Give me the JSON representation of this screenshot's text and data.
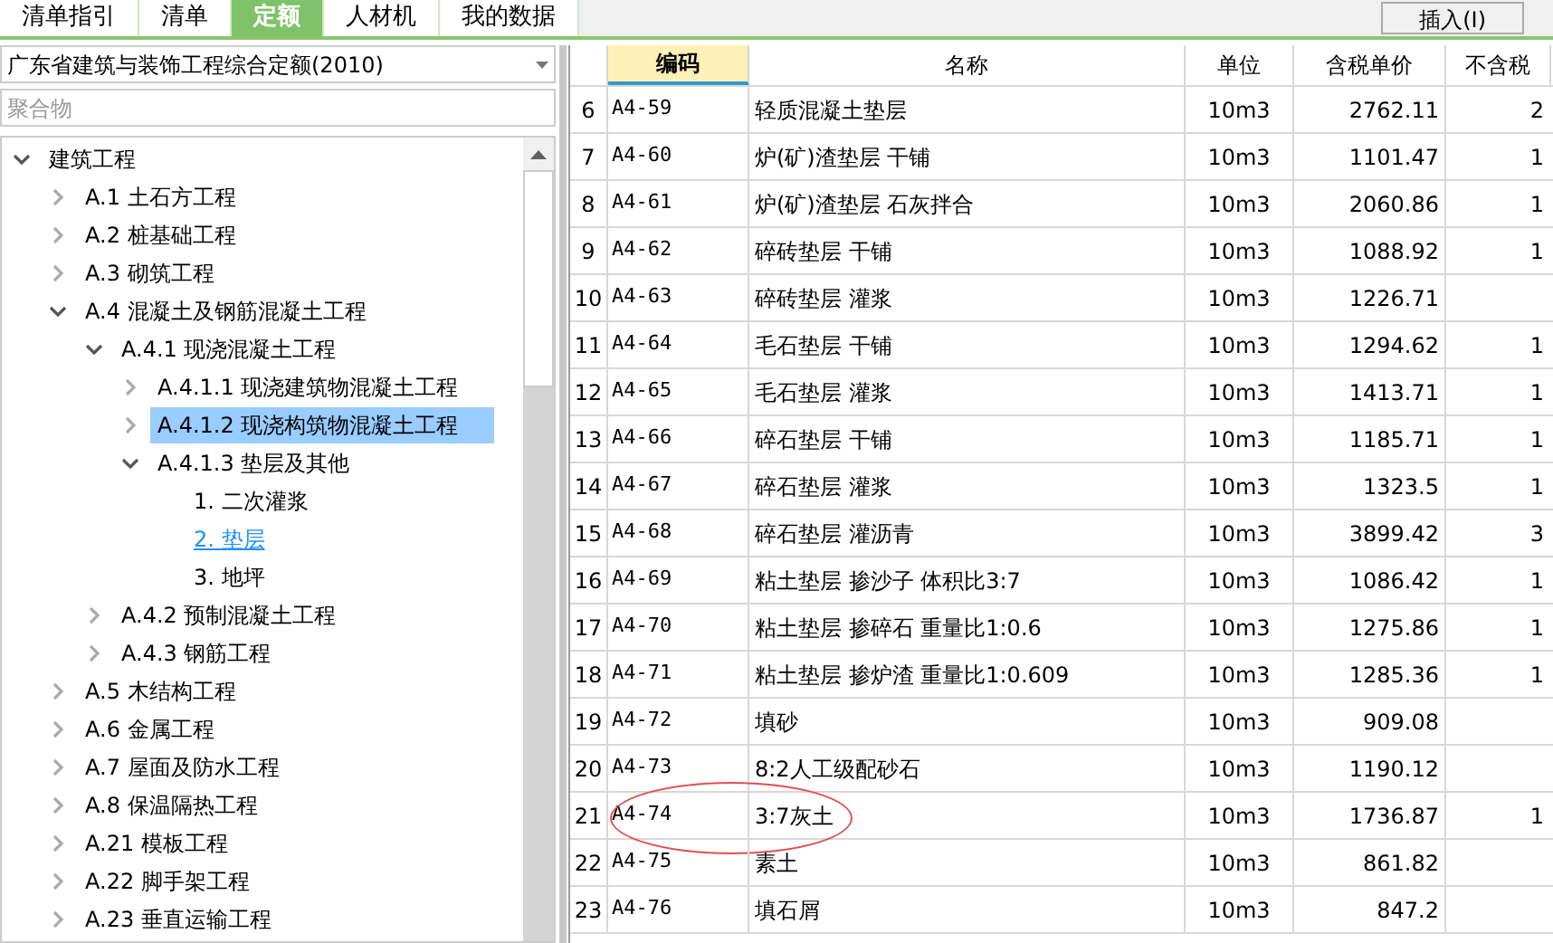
{
  "tabs": [
    {
      "label": "清单指引",
      "selected": false
    },
    {
      "label": "清单",
      "selected": false
    },
    {
      "label": "定额",
      "selected": true
    },
    {
      "label": "人材机",
      "selected": false
    },
    {
      "label": "我的数据",
      "selected": false
    }
  ],
  "insert_button": "插入(I)",
  "library_select": {
    "value": "广东省建筑与装饰工程综合定额(2010)"
  },
  "search": {
    "placeholder": "聚合物"
  },
  "tree": [
    {
      "label": "建筑工程",
      "expanded": true,
      "selected": false,
      "current": false,
      "children": [
        {
          "label": "A.1 土石方工程",
          "expanded": false,
          "selected": false,
          "current": false
        },
        {
          "label": "A.2 桩基础工程",
          "expanded": false,
          "selected": false,
          "current": false
        },
        {
          "label": "A.3 砌筑工程",
          "expanded": false,
          "selected": false,
          "current": false
        },
        {
          "label": "A.4 混凝土及钢筋混凝土工程",
          "expanded": true,
          "selected": false,
          "current": false,
          "children": [
            {
              "label": "A.4.1 现浇混凝土工程",
              "expanded": true,
              "selected": false,
              "current": false,
              "children": [
                {
                  "label": "A.4.1.1 现浇建筑物混凝土工程",
                  "expanded": false,
                  "selected": false,
                  "current": false
                },
                {
                  "label": "A.4.1.2 现浇构筑物混凝土工程",
                  "expanded": false,
                  "selected": true,
                  "current": false
                },
                {
                  "label": "A.4.1.3 垫层及其他",
                  "expanded": true,
                  "selected": false,
                  "current": false,
                  "children": [
                    {
                      "label": "1. 二次灌浆",
                      "selected": false,
                      "current": false
                    },
                    {
                      "label": "2. 垫层",
                      "selected": false,
                      "current": true
                    },
                    {
                      "label": "3. 地坪",
                      "selected": false,
                      "current": false
                    }
                  ]
                }
              ]
            },
            {
              "label": "A.4.2 预制混凝土工程",
              "expanded": false,
              "selected": false,
              "current": false
            },
            {
              "label": "A.4.3 钢筋工程",
              "expanded": false,
              "selected": false,
              "current": false
            }
          ]
        },
        {
          "label": "A.5 木结构工程",
          "expanded": false,
          "selected": false,
          "current": false
        },
        {
          "label": "A.6 金属工程",
          "expanded": false,
          "selected": false,
          "current": false
        },
        {
          "label": "A.7 屋面及防水工程",
          "expanded": false,
          "selected": false,
          "current": false
        },
        {
          "label": "A.8 保温隔热工程",
          "expanded": false,
          "selected": false,
          "current": false
        },
        {
          "label": "A.21 模板工程",
          "expanded": false,
          "selected": false,
          "current": false
        },
        {
          "label": "A.22 脚手架工程",
          "expanded": false,
          "selected": false,
          "current": false
        },
        {
          "label": "A.23 垂直运输工程",
          "expanded": false,
          "selected": false,
          "current": false
        }
      ]
    }
  ],
  "table": {
    "columns": [
      {
        "label": "编码",
        "selected": true
      },
      {
        "label": "名称",
        "selected": false
      },
      {
        "label": "单位",
        "selected": false
      },
      {
        "label": "含税单价",
        "selected": false
      },
      {
        "label": "不含税",
        "selected": false
      }
    ],
    "rows": [
      {
        "index": "6",
        "code": "A4-59",
        "name": "轻质混凝土垫层",
        "unit": "10m3",
        "price": "2762.11",
        "column_5": "2",
        "circled": false
      },
      {
        "index": "7",
        "code": "A4-60",
        "name": "炉(矿)渣垫层 干铺",
        "unit": "10m3",
        "price": "1101.47",
        "column_5": "1",
        "circled": false
      },
      {
        "index": "8",
        "code": "A4-61",
        "name": "炉(矿)渣垫层 石灰拌合",
        "unit": "10m3",
        "price": "2060.86",
        "column_5": "1",
        "circled": false
      },
      {
        "index": "9",
        "code": "A4-62",
        "name": "碎砖垫层 干铺",
        "unit": "10m3",
        "price": "1088.92",
        "column_5": "1",
        "circled": false
      },
      {
        "index": "10",
        "code": "A4-63",
        "name": "碎砖垫层 灌浆",
        "unit": "10m3",
        "price": "1226.71",
        "column_5": "",
        "circled": false
      },
      {
        "index": "11",
        "code": "A4-64",
        "name": "毛石垫层 干铺",
        "unit": "10m3",
        "price": "1294.62",
        "column_5": "1",
        "circled": false
      },
      {
        "index": "12",
        "code": "A4-65",
        "name": "毛石垫层 灌浆",
        "unit": "10m3",
        "price": "1413.71",
        "column_5": "1",
        "circled": false
      },
      {
        "index": "13",
        "code": "A4-66",
        "name": "碎石垫层 干铺",
        "unit": "10m3",
        "price": "1185.71",
        "column_5": "1",
        "circled": false
      },
      {
        "index": "14",
        "code": "A4-67",
        "name": "碎石垫层 灌浆",
        "unit": "10m3",
        "price": "1323.5",
        "column_5": "1",
        "circled": false
      },
      {
        "index": "15",
        "code": "A4-68",
        "name": "碎石垫层 灌沥青",
        "unit": "10m3",
        "price": "3899.42",
        "column_5": "3",
        "circled": false
      },
      {
        "index": "16",
        "code": "A4-69",
        "name": "粘土垫层 掺沙子 体积比3:7",
        "unit": "10m3",
        "price": "1086.42",
        "column_5": "1",
        "circled": false
      },
      {
        "index": "17",
        "code": "A4-70",
        "name": "粘土垫层 掺碎石 重量比1:0.6",
        "unit": "10m3",
        "price": "1275.86",
        "column_5": "1",
        "circled": false
      },
      {
        "index": "18",
        "code": "A4-71",
        "name": "粘土垫层 掺炉渣 重量比1:0.609",
        "unit": "10m3",
        "price": "1285.36",
        "column_5": "1",
        "circled": false
      },
      {
        "index": "19",
        "code": "A4-72",
        "name": "填砂",
        "unit": "10m3",
        "price": "909.08",
        "column_5": "",
        "circled": false
      },
      {
        "index": "20",
        "code": "A4-73",
        "name": "8:2人工级配砂石",
        "unit": "10m3",
        "price": "1190.12",
        "column_5": "",
        "circled": false
      },
      {
        "index": "21",
        "code": "A4-74",
        "name": "3:7灰土",
        "unit": "10m3",
        "price": "1736.87",
        "column_5": "1",
        "circled": true
      },
      {
        "index": "22",
        "code": "A4-75",
        "name": "素土",
        "unit": "10m3",
        "price": "861.82",
        "column_5": "",
        "circled": false
      },
      {
        "index": "23",
        "code": "A4-76",
        "name": "填石屑",
        "unit": "10m3",
        "price": "847.2",
        "column_5": "",
        "circled": false
      }
    ]
  }
}
